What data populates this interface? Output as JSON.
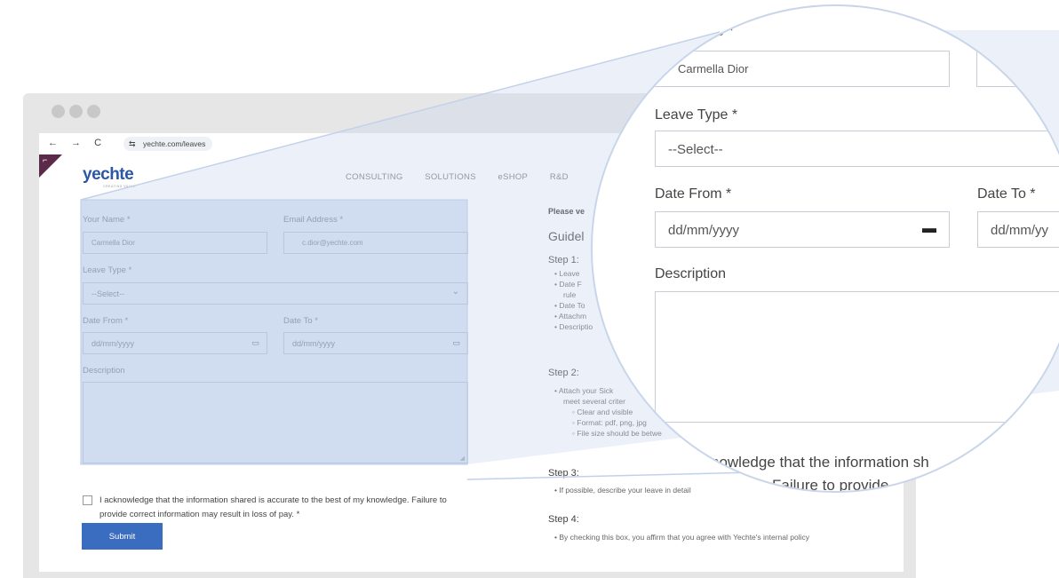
{
  "browser": {
    "url": "yechte.com/leaves",
    "nav_glyphs": "← → C"
  },
  "brand": {
    "name": "yechte",
    "tagline": "CREATING VALUE"
  },
  "topnav": [
    "CONSULTING",
    "SOLUTIONS",
    "eSHOP",
    "R&D"
  ],
  "form": {
    "name_label": "Your Name *",
    "name_value": "Carmella Dior",
    "email_label": "Email Address *",
    "email_value": "c.dior@yechte.com",
    "leave_type_label": "Leave Type *",
    "leave_type_value": "--Select--",
    "date_from_label": "Date From *",
    "date_from_value": "dd/mm/yyyy",
    "date_to_label": "Date To *",
    "date_to_value": "dd/mm/yyyy",
    "description_label": "Description",
    "ack_text": "I acknowledge that the information shared is accurate to the best of my knowledge. Failure to provide correct information may result in loss of pay. *",
    "submit_label": "Submit"
  },
  "guidelines": {
    "notice": "Please ve",
    "title": "Guidel",
    "step1": "Step 1:",
    "step1_items": [
      "Leave",
      "Date F",
      "rule",
      "Date To",
      "Attachm",
      "Descriptio"
    ],
    "step2": "Step 2:",
    "step2_items": [
      "Attach your Sick",
      "meet several criter"
    ],
    "step2_sub": [
      "Clear and visible",
      "Format: pdf, png, jpg",
      "File size should be betwe"
    ],
    "step3": "Step 3:",
    "step3_item": "If possible, describe your leave in detail",
    "step4": "Step 4:",
    "step4_item": "By checking this box, you affirm that you agree with Yechte's internal policy"
  },
  "magnifier": {
    "name_label_partial": "ne *",
    "name_value": "Carmella Dior",
    "leave_type_label": "Leave Type *",
    "leave_type_value": "--Select--",
    "date_from_label": "Date From *",
    "date_from_value": "dd/mm/yyyy",
    "date_to_label": "Date To *",
    "date_to_value": "dd/mm/yy",
    "description_label": "Description",
    "ack_partial_1": "nowledge that the information sh",
    "ack_partial_2": "Failure to provide"
  },
  "colors": {
    "accent": "#3a6cc0",
    "highlight": "#c9d7ee",
    "brand_corner": "#5b2a4a"
  }
}
